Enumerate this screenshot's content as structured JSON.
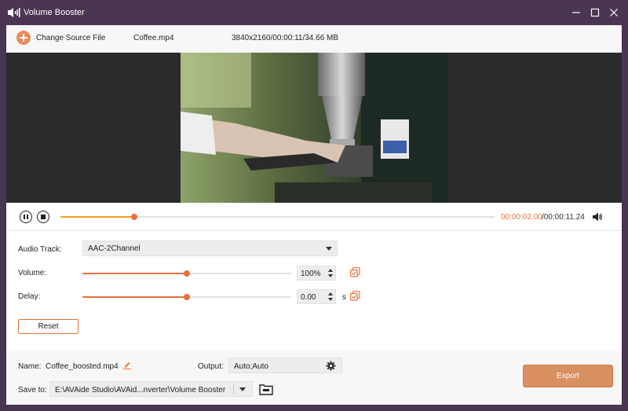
{
  "window": {
    "title": "Volume Booster",
    "controls": [
      "minimize-icon",
      "maximize-icon",
      "close-icon"
    ]
  },
  "source": {
    "change_label": "Change Source File",
    "file_name": "Coffee.mp4",
    "file_info": "3840x2160/00:00:11/34.66 MB"
  },
  "playback": {
    "current_time": "00:00:02.00",
    "total_time": "/00:00:11.24",
    "progress_fraction": 0.17
  },
  "settings": {
    "audio_track_label": "Audio Track:",
    "audio_track_value": "AAC-2Channel",
    "volume_label": "Volume:",
    "volume_value": "100%",
    "volume_fraction": 0.5,
    "delay_label": "Delay:",
    "delay_value": "0.00",
    "delay_unit": "s",
    "delay_fraction": 0.5,
    "reset_label": "Reset"
  },
  "output": {
    "name_label": "Name:",
    "name_value": "Coffee_boosted.mp4",
    "output_label": "Output:",
    "output_value": "Auto;Auto",
    "save_label": "Save to:",
    "save_value": "E:\\AVAide Studio\\AVAid...nverter\\Volume Booster",
    "export_label": "Export"
  },
  "colors": {
    "accent": "#e8713c",
    "progress": "#f0a020",
    "titlebar": "#4a3552",
    "export": "#d99060"
  }
}
